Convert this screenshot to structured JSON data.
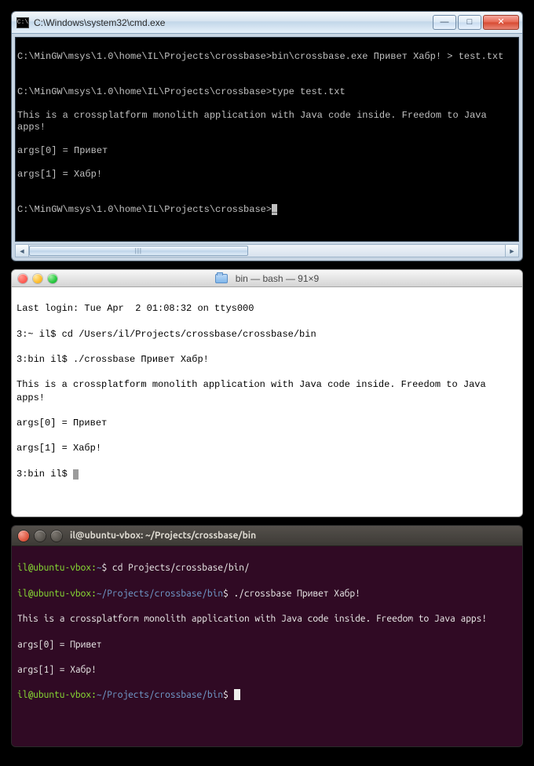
{
  "windows": {
    "title": "C:\\Windows\\system32\\cmd.exe",
    "app_icon_label": "C:\\",
    "buttons": {
      "min": "—",
      "max": "□",
      "close": "✕"
    },
    "lines": {
      "l0": "C:\\MinGW\\msys\\1.0\\home\\IL\\Projects\\crossbase>bin\\crossbase.exe Привет Хабр! > test.txt",
      "l1": "",
      "l2": "C:\\MinGW\\msys\\1.0\\home\\IL\\Projects\\crossbase>type test.txt",
      "l3": "This is a crossplatform monolith application with Java code inside. Freedom to Java apps!",
      "l4": "args[0] = Привет",
      "l5": "args[1] = Хабр!",
      "l6": "",
      "l7_prompt": "C:\\MinGW\\msys\\1.0\\home\\IL\\Projects\\crossbase>",
      "l7_cursor": "_"
    },
    "scroll_thumb": "|||"
  },
  "mac": {
    "title": "bin — bash — 91×9",
    "lines": {
      "l0": "Last login: Tue Apr  2 01:08:32 on ttys000",
      "l1": "3:~ il$ cd /Users/il/Projects/crossbase/crossbase/bin",
      "l2": "3:bin il$ ./crossbase Привет Хабр!",
      "l3": "This is a crossplatform monolith application with Java code inside. Freedom to Java apps!",
      "l4": "args[0] = Привет",
      "l5": "args[1] = Хабр!",
      "l6_prompt": "3:bin il$ "
    }
  },
  "ubuntu": {
    "title": "il@ubuntu-vbox: ~/Projects/crossbase/bin",
    "p1_user": "il@ubuntu-vbox:",
    "p1_path": "~",
    "p1_sym": "$ ",
    "p1_cmd": "cd Projects/crossbase/bin/",
    "p2_user": "il@ubuntu-vbox:",
    "p2_path": "~/Projects/crossbase/bin",
    "p2_sym": "$ ",
    "p2_cmd": "./crossbase Привет Хабр!",
    "out1": "This is a crossplatform monolith application with Java code inside. Freedom to Java apps!",
    "out2": "args[0] = Привет",
    "out3": "args[1] = Хабр!",
    "p3_user": "il@ubuntu-vbox:",
    "p3_path": "~/Projects/crossbase/bin",
    "p3_sym": "$ "
  }
}
